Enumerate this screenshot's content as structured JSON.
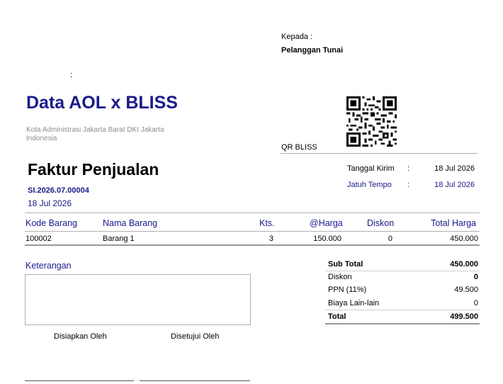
{
  "recipient": {
    "label": "Kepada :",
    "name": "Pelanggan Tunai"
  },
  "top_colon": ":",
  "company": {
    "name": "Data AOL x BLISS",
    "address": "Kota Administrasi Jakarta Barat DKI Jakarta Indonesia"
  },
  "qr": {
    "label": "QR BLISS",
    "icon": "qr-code-icon"
  },
  "invoice": {
    "title": "Faktur Penjualan",
    "number": "SI.2026.07.00004",
    "date": "18 Jul 2026",
    "meta": [
      {
        "label": "Tanggal Kirim",
        "colon": ":",
        "value": "18 Jul 2026",
        "color": "#000000"
      },
      {
        "label": "Jatuh Tempo",
        "colon": ":",
        "value": "18 Jul 2026",
        "color": "#1a1a8c"
      }
    ]
  },
  "table": {
    "headers": {
      "code": "Kode Barang",
      "name": "Nama Barang",
      "qty": "Kts.",
      "price": "@Harga",
      "discount": "Diskon",
      "total": "Total Harga"
    },
    "rows": [
      {
        "code": "100002",
        "name": "Barang 1",
        "qty": "3",
        "price": "150.000",
        "discount": "0",
        "total": "450.000"
      }
    ]
  },
  "notes": {
    "label": "Keterangan",
    "text": ""
  },
  "totals": {
    "subtotal": {
      "label": "Sub Total",
      "value": "450.000"
    },
    "discount": {
      "label": "Diskon",
      "value": "0"
    },
    "tax": {
      "label": "PPN (11%)",
      "value": "49.500"
    },
    "other": {
      "label": "Biaya Lain-lain",
      "value": "0"
    },
    "total": {
      "label": "Total",
      "value": "499.500"
    }
  },
  "signatures": {
    "prepared": "Disiapkan Oleh",
    "approved": "Disetujui Oleh"
  },
  "colors": {
    "accent": "#1a1a8c",
    "muted": "#8c8c8c",
    "line": "#b0b0b0"
  }
}
